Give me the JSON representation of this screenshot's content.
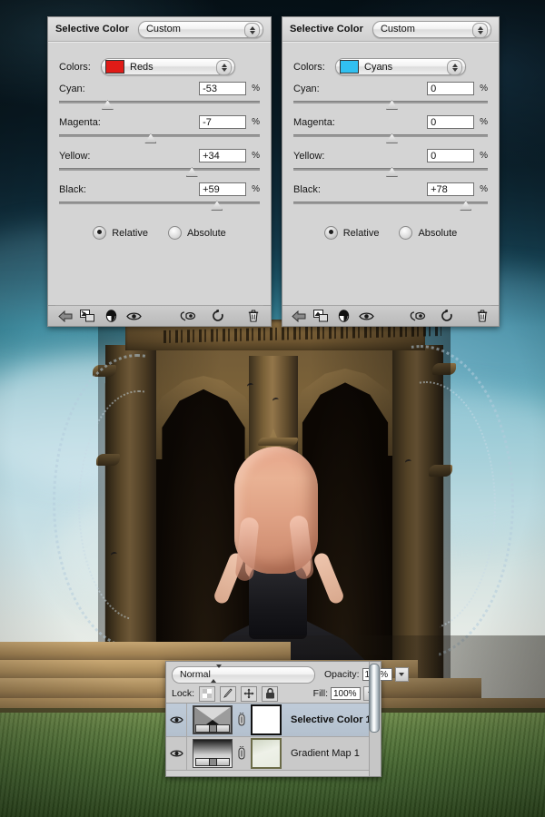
{
  "panels": [
    {
      "id": "selective-color-left",
      "title": "Selective Color",
      "preset": "Custom",
      "colors_label": "Colors:",
      "color_channel": "Reds",
      "swatch_color": "#e01b17",
      "sliders": [
        {
          "label": "Cyan:",
          "value": "-53",
          "unit": "%",
          "pos": 23.5
        },
        {
          "label": "Magenta:",
          "value": "-7",
          "unit": "%",
          "pos": 45.0
        },
        {
          "label": "Yellow:",
          "value": "+34",
          "unit": "%",
          "pos": 65.5
        },
        {
          "label": "Black:",
          "value": "+59",
          "unit": "%",
          "pos": 78.0
        }
      ],
      "method": {
        "relative_label": "Relative",
        "absolute_label": "Absolute",
        "selected": "Relative"
      },
      "footer_icons": [
        "back-arrow-icon",
        "clip-to-layer-icon",
        "adjustment-half-circle-icon",
        "eye-icon",
        "preview-eye-icon",
        "reset-icon",
        "trash-icon"
      ]
    },
    {
      "id": "selective-color-right",
      "title": "Selective Color",
      "preset": "Custom",
      "colors_label": "Colors:",
      "color_channel": "Cyans",
      "swatch_color": "#31c0f0",
      "sliders": [
        {
          "label": "Cyan:",
          "value": "0",
          "unit": "%",
          "pos": 50.0
        },
        {
          "label": "Magenta:",
          "value": "0",
          "unit": "%",
          "pos": 50.0
        },
        {
          "label": "Yellow:",
          "value": "0",
          "unit": "%",
          "pos": 50.0
        },
        {
          "label": "Black:",
          "value": "+78",
          "unit": "%",
          "pos": 88.0
        }
      ],
      "method": {
        "relative_label": "Relative",
        "absolute_label": "Absolute",
        "selected": "Relative"
      },
      "footer_icons": [
        "back-arrow-icon",
        "clip-to-layer-icon",
        "adjustment-half-circle-icon",
        "eye-icon",
        "preview-eye-icon",
        "reset-icon",
        "trash-icon"
      ]
    }
  ],
  "layers_panel": {
    "blend_mode": "Normal",
    "opacity_label": "Opacity:",
    "opacity_value": "100%",
    "lock_label": "Lock:",
    "lock_icons": [
      "lock-transparency-icon",
      "lock-image-pixels-icon",
      "lock-position-icon",
      "lock-all-icon"
    ],
    "fill_label": "Fill:",
    "fill_value": "100%",
    "layers": [
      {
        "name": "Selective Color 1",
        "visible": true,
        "selected": true,
        "thumb": "selective-color-thumb",
        "mask": "white-mask"
      },
      {
        "name": "Gradient Map 1",
        "visible": true,
        "selected": false,
        "thumb": "gradient-map-thumb",
        "mask": "gradient-mask"
      }
    ]
  },
  "artwork": {
    "description": "gothic-monument-woman-composite"
  }
}
